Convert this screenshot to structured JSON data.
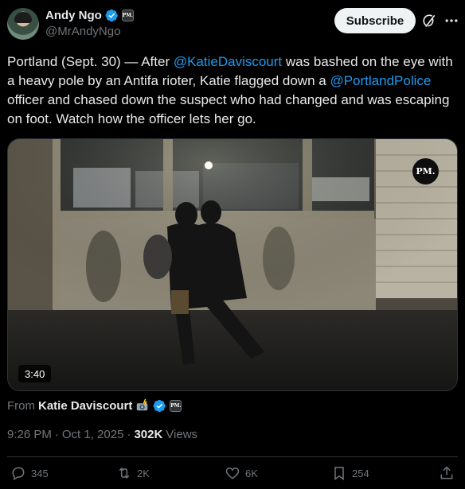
{
  "author": {
    "name": "Andy Ngo",
    "handle": "@MrAndyNgo",
    "affiliate_badge": "PM."
  },
  "header": {
    "subscribe_label": "Subscribe",
    "grok_icon": "grok-icon",
    "more_icon": "more-dots-icon"
  },
  "tweet": {
    "text_segments": {
      "p1": "Portland (Sept. 30) — After ",
      "m1": "@KatieDaviscourt",
      "p2": " was bashed on the eye with a heavy pole by an Antifa rioter, Katie flagged down a ",
      "m2": "@PortlandPolice",
      "p3": " officer and chased down the suspect who had changed and was escaping on foot. Watch how the officer lets her go."
    }
  },
  "media": {
    "watermark": "PM.",
    "duration": "3:40"
  },
  "attribution": {
    "from_label": "From",
    "from_name": "Katie Daviscourt"
  },
  "meta": {
    "time": "9:26 PM",
    "separator": "·",
    "date": "Oct 1, 2025",
    "views_count": "302K",
    "views_label": "Views"
  },
  "actions": {
    "replies": "345",
    "reposts": "2K",
    "likes": "6K",
    "bookmarks": "254"
  },
  "colors": {
    "background": "#000000",
    "text": "#e7e9ea",
    "secondary": "#71767b",
    "link": "#1d9bf0",
    "verified": "#1d9bf0",
    "subscribe_bg": "#eff3f4"
  }
}
